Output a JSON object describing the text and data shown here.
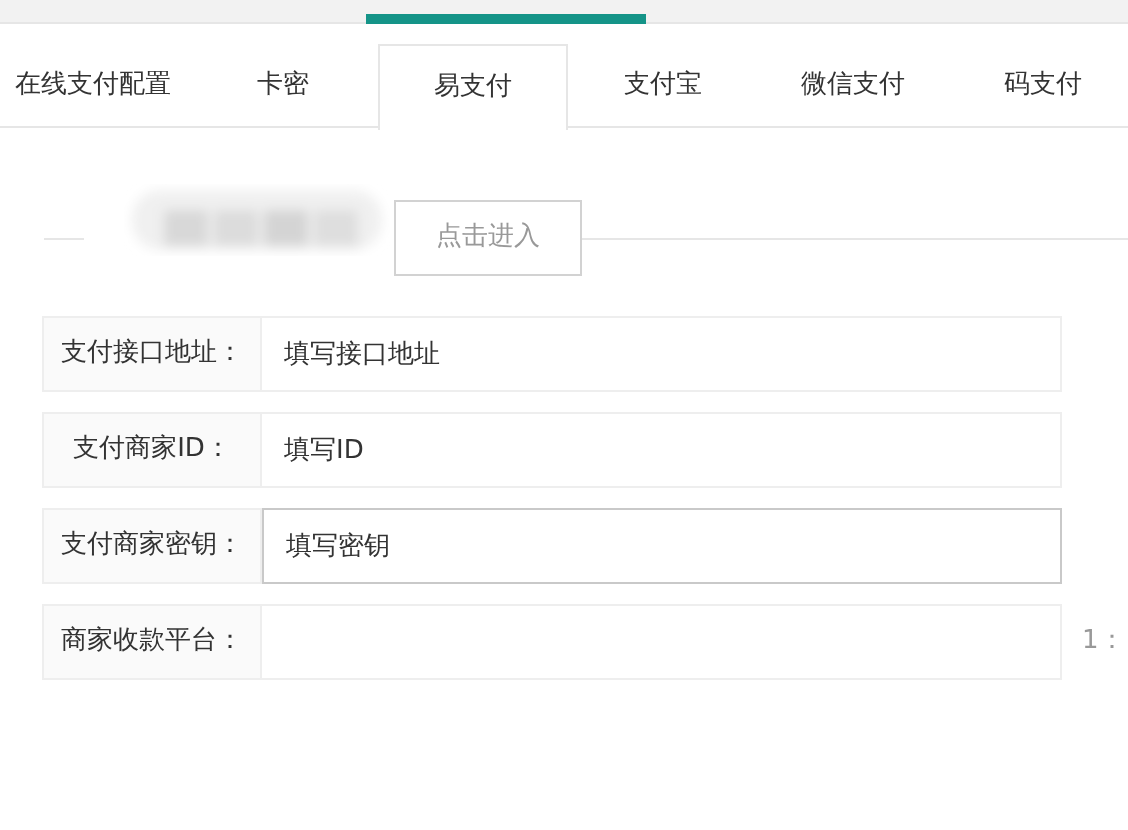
{
  "tabs": [
    {
      "label": "在线支付配置",
      "selected": false
    },
    {
      "label": "卡密",
      "selected": false
    },
    {
      "label": "易支付",
      "selected": true
    },
    {
      "label": "支付宝",
      "selected": false
    },
    {
      "label": "微信支付",
      "selected": false
    },
    {
      "label": "码支付",
      "selected": false
    }
  ],
  "enter_button": "点击进入",
  "fields": [
    {
      "label": "支付接口地址：",
      "value": "填写接口地址",
      "focused": false
    },
    {
      "label": "支付商家ID：",
      "value": "填写ID",
      "focused": false
    },
    {
      "label": "支付商家密钥：",
      "value": "填写密钥",
      "focused": true
    },
    {
      "label": "商家收款平台：",
      "focused": false,
      "hint": "1："
    }
  ]
}
